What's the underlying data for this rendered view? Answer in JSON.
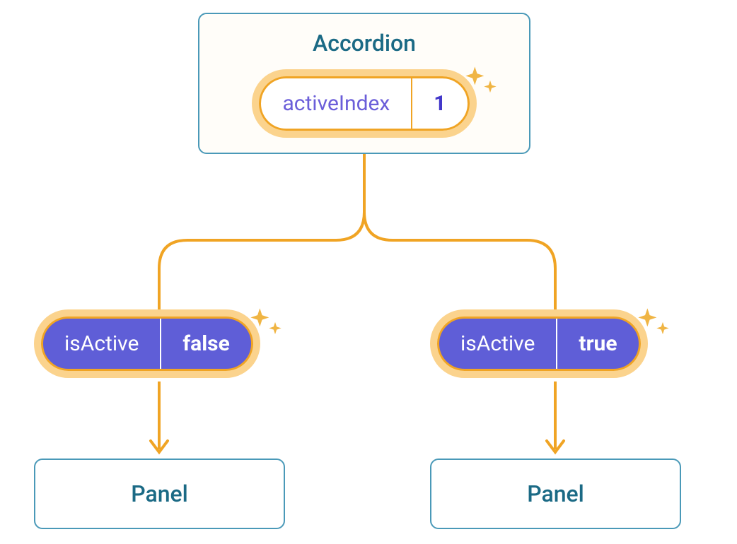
{
  "diagram": {
    "parent": {
      "title": "Accordion",
      "state_label": "activeIndex",
      "state_value": "1"
    },
    "children": [
      {
        "prop_label": "isActive",
        "prop_value": "false",
        "panel_title": "Panel"
      },
      {
        "prop_label": "isActive",
        "prop_value": "true",
        "panel_title": "Panel"
      }
    ]
  }
}
